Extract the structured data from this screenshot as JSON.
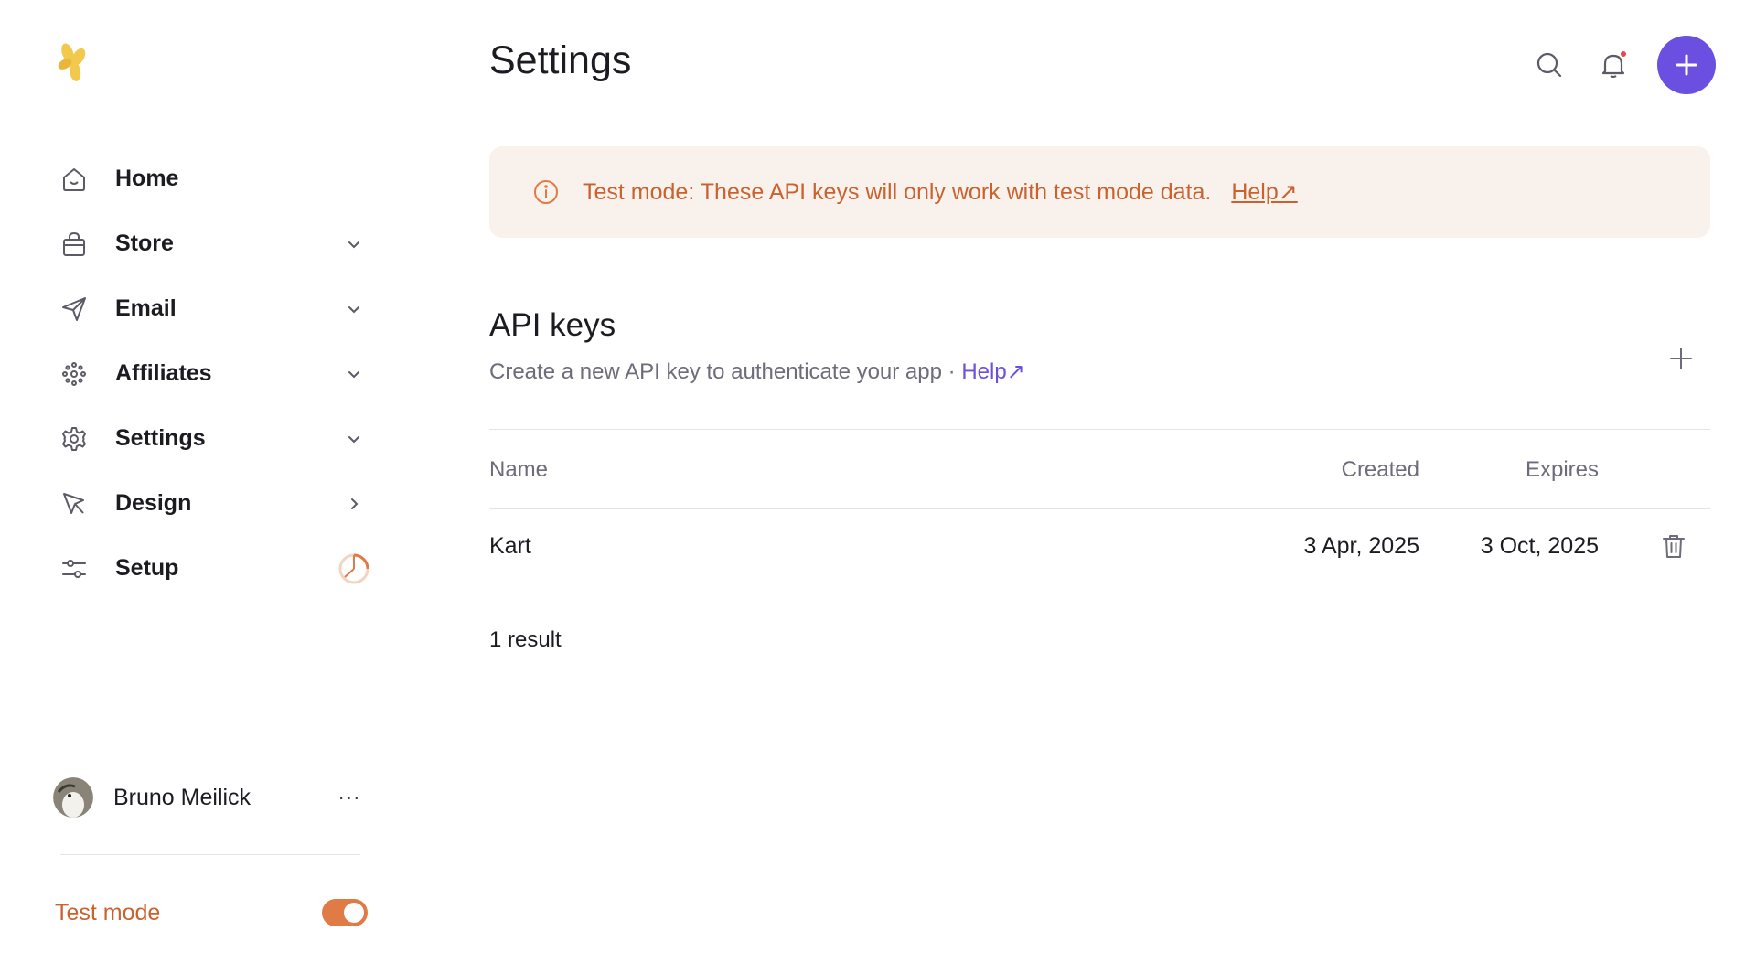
{
  "app": {
    "logo_icon": "flower-logo-icon"
  },
  "sidebar": {
    "items": [
      {
        "label": "Home",
        "icon": "home-icon",
        "caret": ""
      },
      {
        "label": "Store",
        "icon": "bag-icon",
        "caret": "chevron-down"
      },
      {
        "label": "Email",
        "icon": "send-icon",
        "caret": "chevron-down"
      },
      {
        "label": "Affiliates",
        "icon": "affiliates-icon",
        "caret": "chevron-down"
      },
      {
        "label": "Settings",
        "icon": "gear-icon",
        "caret": "chevron-down"
      },
      {
        "label": "Design",
        "icon": "cursor-icon",
        "caret": "chevron-right"
      },
      {
        "label": "Setup",
        "icon": "sliders-icon",
        "caret": "progress-ring"
      }
    ],
    "user": {
      "name": "Bruno Meilick",
      "more": "···"
    },
    "test_mode": {
      "label": "Test mode",
      "enabled": true
    }
  },
  "header": {
    "title": "Settings"
  },
  "banner": {
    "text": "Test mode: These API keys will only work with test mode data.",
    "help": "Help↗"
  },
  "api_keys": {
    "title": "API keys",
    "description": "Create a new API key to authenticate your app · ",
    "help": "Help↗",
    "columns": {
      "name": "Name",
      "created": "Created",
      "expires": "Expires"
    },
    "rows": [
      {
        "name": "Kart",
        "created": "3 Apr, 2025",
        "expires": "3 Oct, 2025"
      }
    ],
    "result_count": "1 result"
  },
  "colors": {
    "accent": "#6b4fe0",
    "warning_text": "#c9622e",
    "warning_bg": "#f9f2ec",
    "toggle": "#e07b46"
  }
}
